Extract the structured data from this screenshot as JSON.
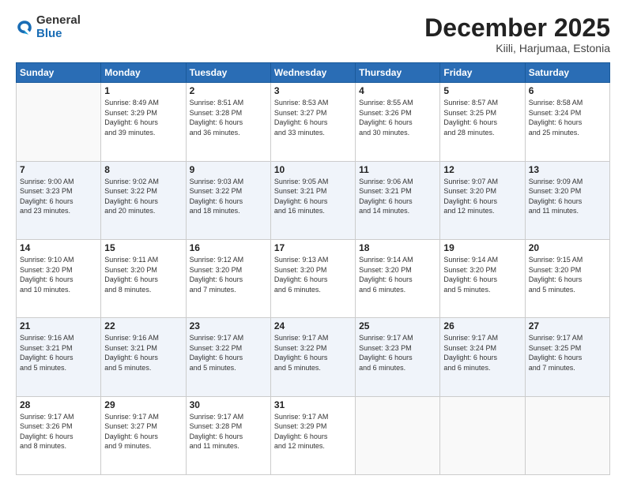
{
  "logo": {
    "general": "General",
    "blue": "Blue"
  },
  "header": {
    "month": "December 2025",
    "location": "Kiili, Harjumaa, Estonia"
  },
  "weekdays": [
    "Sunday",
    "Monday",
    "Tuesday",
    "Wednesday",
    "Thursday",
    "Friday",
    "Saturday"
  ],
  "weeks": [
    [
      {
        "day": "",
        "info": ""
      },
      {
        "day": "1",
        "info": "Sunrise: 8:49 AM\nSunset: 3:29 PM\nDaylight: 6 hours\nand 39 minutes."
      },
      {
        "day": "2",
        "info": "Sunrise: 8:51 AM\nSunset: 3:28 PM\nDaylight: 6 hours\nand 36 minutes."
      },
      {
        "day": "3",
        "info": "Sunrise: 8:53 AM\nSunset: 3:27 PM\nDaylight: 6 hours\nand 33 minutes."
      },
      {
        "day": "4",
        "info": "Sunrise: 8:55 AM\nSunset: 3:26 PM\nDaylight: 6 hours\nand 30 minutes."
      },
      {
        "day": "5",
        "info": "Sunrise: 8:57 AM\nSunset: 3:25 PM\nDaylight: 6 hours\nand 28 minutes."
      },
      {
        "day": "6",
        "info": "Sunrise: 8:58 AM\nSunset: 3:24 PM\nDaylight: 6 hours\nand 25 minutes."
      }
    ],
    [
      {
        "day": "7",
        "info": "Sunrise: 9:00 AM\nSunset: 3:23 PM\nDaylight: 6 hours\nand 23 minutes."
      },
      {
        "day": "8",
        "info": "Sunrise: 9:02 AM\nSunset: 3:22 PM\nDaylight: 6 hours\nand 20 minutes."
      },
      {
        "day": "9",
        "info": "Sunrise: 9:03 AM\nSunset: 3:22 PM\nDaylight: 6 hours\nand 18 minutes."
      },
      {
        "day": "10",
        "info": "Sunrise: 9:05 AM\nSunset: 3:21 PM\nDaylight: 6 hours\nand 16 minutes."
      },
      {
        "day": "11",
        "info": "Sunrise: 9:06 AM\nSunset: 3:21 PM\nDaylight: 6 hours\nand 14 minutes."
      },
      {
        "day": "12",
        "info": "Sunrise: 9:07 AM\nSunset: 3:20 PM\nDaylight: 6 hours\nand 12 minutes."
      },
      {
        "day": "13",
        "info": "Sunrise: 9:09 AM\nSunset: 3:20 PM\nDaylight: 6 hours\nand 11 minutes."
      }
    ],
    [
      {
        "day": "14",
        "info": "Sunrise: 9:10 AM\nSunset: 3:20 PM\nDaylight: 6 hours\nand 10 minutes."
      },
      {
        "day": "15",
        "info": "Sunrise: 9:11 AM\nSunset: 3:20 PM\nDaylight: 6 hours\nand 8 minutes."
      },
      {
        "day": "16",
        "info": "Sunrise: 9:12 AM\nSunset: 3:20 PM\nDaylight: 6 hours\nand 7 minutes."
      },
      {
        "day": "17",
        "info": "Sunrise: 9:13 AM\nSunset: 3:20 PM\nDaylight: 6 hours\nand 6 minutes."
      },
      {
        "day": "18",
        "info": "Sunrise: 9:14 AM\nSunset: 3:20 PM\nDaylight: 6 hours\nand 6 minutes."
      },
      {
        "day": "19",
        "info": "Sunrise: 9:14 AM\nSunset: 3:20 PM\nDaylight: 6 hours\nand 5 minutes."
      },
      {
        "day": "20",
        "info": "Sunrise: 9:15 AM\nSunset: 3:20 PM\nDaylight: 6 hours\nand 5 minutes."
      }
    ],
    [
      {
        "day": "21",
        "info": "Sunrise: 9:16 AM\nSunset: 3:21 PM\nDaylight: 6 hours\nand 5 minutes."
      },
      {
        "day": "22",
        "info": "Sunrise: 9:16 AM\nSunset: 3:21 PM\nDaylight: 6 hours\nand 5 minutes."
      },
      {
        "day": "23",
        "info": "Sunrise: 9:17 AM\nSunset: 3:22 PM\nDaylight: 6 hours\nand 5 minutes."
      },
      {
        "day": "24",
        "info": "Sunrise: 9:17 AM\nSunset: 3:22 PM\nDaylight: 6 hours\nand 5 minutes."
      },
      {
        "day": "25",
        "info": "Sunrise: 9:17 AM\nSunset: 3:23 PM\nDaylight: 6 hours\nand 6 minutes."
      },
      {
        "day": "26",
        "info": "Sunrise: 9:17 AM\nSunset: 3:24 PM\nDaylight: 6 hours\nand 6 minutes."
      },
      {
        "day": "27",
        "info": "Sunrise: 9:17 AM\nSunset: 3:25 PM\nDaylight: 6 hours\nand 7 minutes."
      }
    ],
    [
      {
        "day": "28",
        "info": "Sunrise: 9:17 AM\nSunset: 3:26 PM\nDaylight: 6 hours\nand 8 minutes."
      },
      {
        "day": "29",
        "info": "Sunrise: 9:17 AM\nSunset: 3:27 PM\nDaylight: 6 hours\nand 9 minutes."
      },
      {
        "day": "30",
        "info": "Sunrise: 9:17 AM\nSunset: 3:28 PM\nDaylight: 6 hours\nand 11 minutes."
      },
      {
        "day": "31",
        "info": "Sunrise: 9:17 AM\nSunset: 3:29 PM\nDaylight: 6 hours\nand 12 minutes."
      },
      {
        "day": "",
        "info": ""
      },
      {
        "day": "",
        "info": ""
      },
      {
        "day": "",
        "info": ""
      }
    ]
  ]
}
